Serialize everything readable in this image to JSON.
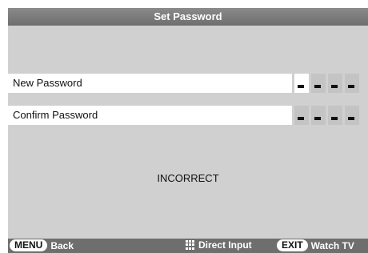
{
  "title": "Set Password",
  "fields": {
    "new": {
      "label": "New Password",
      "digits": 4,
      "filled": 1
    },
    "confirm": {
      "label": "Confirm Password",
      "digits": 4,
      "filled": 0
    }
  },
  "message": "INCORRECT",
  "footer": {
    "menu_key": "MENU",
    "menu_label": "Back",
    "direct_label": "Direct Input",
    "exit_key": "EXIT",
    "exit_label": "Watch TV"
  },
  "colors": {
    "background": "#d0d0d0",
    "title_bar": "#7a7a7a",
    "footer_bar": "#6e6e6e"
  },
  "icons": [
    "number-grid-icon"
  ]
}
